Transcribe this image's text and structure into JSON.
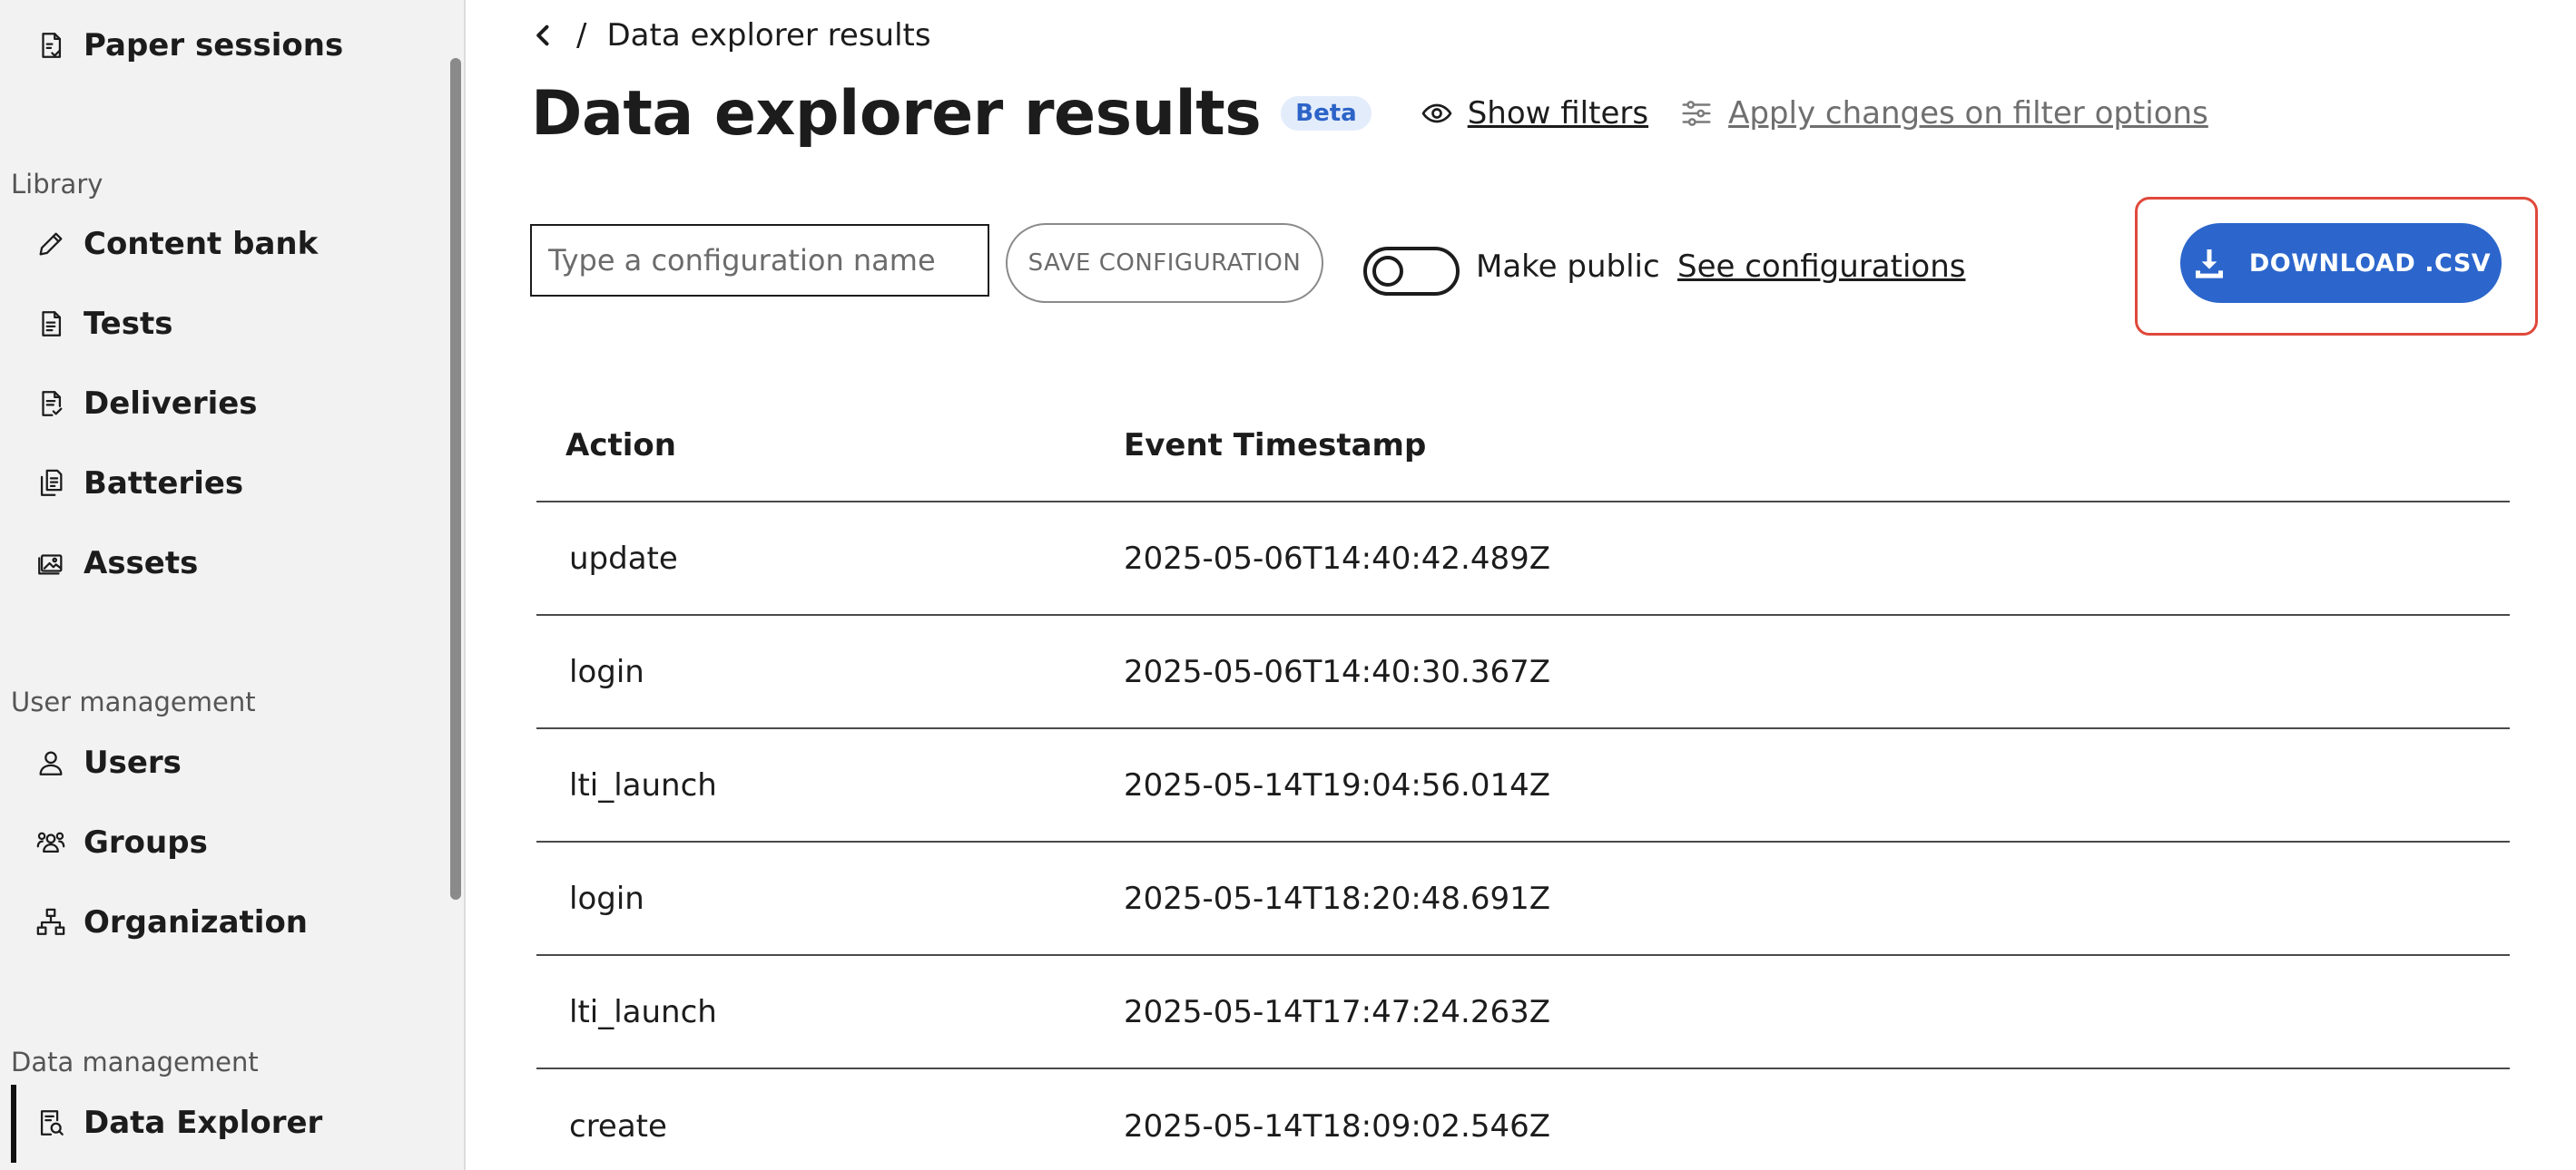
{
  "sidebar": {
    "top_item": {
      "label": "Paper sessions",
      "icon": "paper-sessions-icon"
    },
    "sections": [
      {
        "label": "Library",
        "items": [
          {
            "label": "Content bank",
            "icon": "pencil-icon"
          },
          {
            "label": "Tests",
            "icon": "document-icon"
          },
          {
            "label": "Deliveries",
            "icon": "document-check-icon"
          },
          {
            "label": "Batteries",
            "icon": "document-stack-icon"
          },
          {
            "label": "Assets",
            "icon": "image-icon"
          }
        ]
      },
      {
        "label": "User management",
        "items": [
          {
            "label": "Users",
            "icon": "user-icon"
          },
          {
            "label": "Groups",
            "icon": "group-icon"
          },
          {
            "label": "Organization",
            "icon": "hierarchy-icon"
          }
        ]
      },
      {
        "label": "Data management",
        "items": [
          {
            "label": "Data Explorer",
            "icon": "data-search-icon",
            "active": true
          }
        ]
      }
    ]
  },
  "breadcrumb": {
    "separator": "/",
    "current": "Data explorer results"
  },
  "header": {
    "title": "Data explorer results",
    "badge": "Beta",
    "show_filters": "Show filters",
    "apply_changes": "Apply changes on filter options"
  },
  "config": {
    "placeholder": "Type a configuration name",
    "value": "",
    "save_label": "SAVE CONFIGURATION",
    "make_public_label": "Make public",
    "make_public_on": false,
    "see_configs_label": "See configurations",
    "download_label": "DOWNLOAD .CSV"
  },
  "colors": {
    "accent": "#2c66cc",
    "highlight": "#e0483b",
    "badge_bg": "#e3ecfb",
    "badge_text": "#2c63c7"
  },
  "table": {
    "columns": [
      "Action",
      "Event Timestamp"
    ],
    "rows": [
      [
        "update",
        "2025-05-06T14:40:42.489Z"
      ],
      [
        "login",
        "2025-05-06T14:40:30.367Z"
      ],
      [
        "lti_launch",
        "2025-05-14T19:04:56.014Z"
      ],
      [
        "login",
        "2025-05-14T18:20:48.691Z"
      ],
      [
        "lti_launch",
        "2025-05-14T17:47:24.263Z"
      ],
      [
        "create",
        "2025-05-14T18:09:02.546Z"
      ]
    ]
  }
}
